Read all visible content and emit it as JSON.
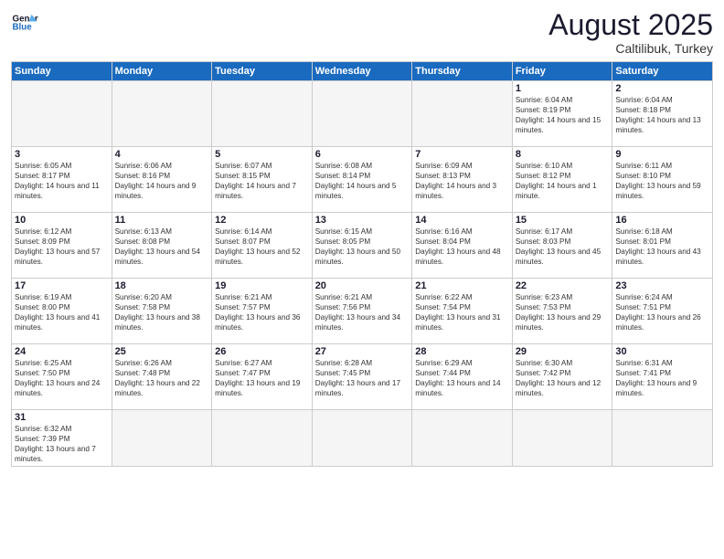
{
  "header": {
    "logo_line1": "General",
    "logo_line2": "Blue",
    "month_title": "August 2025",
    "subtitle": "Caltilibuk, Turkey"
  },
  "weekdays": [
    "Sunday",
    "Monday",
    "Tuesday",
    "Wednesday",
    "Thursday",
    "Friday",
    "Saturday"
  ],
  "weeks": [
    [
      {
        "day": "",
        "info": ""
      },
      {
        "day": "",
        "info": ""
      },
      {
        "day": "",
        "info": ""
      },
      {
        "day": "",
        "info": ""
      },
      {
        "day": "",
        "info": ""
      },
      {
        "day": "1",
        "info": "Sunrise: 6:04 AM\nSunset: 8:19 PM\nDaylight: 14 hours and 15 minutes."
      },
      {
        "day": "2",
        "info": "Sunrise: 6:04 AM\nSunset: 8:18 PM\nDaylight: 14 hours and 13 minutes."
      }
    ],
    [
      {
        "day": "3",
        "info": "Sunrise: 6:05 AM\nSunset: 8:17 PM\nDaylight: 14 hours and 11 minutes."
      },
      {
        "day": "4",
        "info": "Sunrise: 6:06 AM\nSunset: 8:16 PM\nDaylight: 14 hours and 9 minutes."
      },
      {
        "day": "5",
        "info": "Sunrise: 6:07 AM\nSunset: 8:15 PM\nDaylight: 14 hours and 7 minutes."
      },
      {
        "day": "6",
        "info": "Sunrise: 6:08 AM\nSunset: 8:14 PM\nDaylight: 14 hours and 5 minutes."
      },
      {
        "day": "7",
        "info": "Sunrise: 6:09 AM\nSunset: 8:13 PM\nDaylight: 14 hours and 3 minutes."
      },
      {
        "day": "8",
        "info": "Sunrise: 6:10 AM\nSunset: 8:12 PM\nDaylight: 14 hours and 1 minute."
      },
      {
        "day": "9",
        "info": "Sunrise: 6:11 AM\nSunset: 8:10 PM\nDaylight: 13 hours and 59 minutes."
      }
    ],
    [
      {
        "day": "10",
        "info": "Sunrise: 6:12 AM\nSunset: 8:09 PM\nDaylight: 13 hours and 57 minutes."
      },
      {
        "day": "11",
        "info": "Sunrise: 6:13 AM\nSunset: 8:08 PM\nDaylight: 13 hours and 54 minutes."
      },
      {
        "day": "12",
        "info": "Sunrise: 6:14 AM\nSunset: 8:07 PM\nDaylight: 13 hours and 52 minutes."
      },
      {
        "day": "13",
        "info": "Sunrise: 6:15 AM\nSunset: 8:05 PM\nDaylight: 13 hours and 50 minutes."
      },
      {
        "day": "14",
        "info": "Sunrise: 6:16 AM\nSunset: 8:04 PM\nDaylight: 13 hours and 48 minutes."
      },
      {
        "day": "15",
        "info": "Sunrise: 6:17 AM\nSunset: 8:03 PM\nDaylight: 13 hours and 45 minutes."
      },
      {
        "day": "16",
        "info": "Sunrise: 6:18 AM\nSunset: 8:01 PM\nDaylight: 13 hours and 43 minutes."
      }
    ],
    [
      {
        "day": "17",
        "info": "Sunrise: 6:19 AM\nSunset: 8:00 PM\nDaylight: 13 hours and 41 minutes."
      },
      {
        "day": "18",
        "info": "Sunrise: 6:20 AM\nSunset: 7:58 PM\nDaylight: 13 hours and 38 minutes."
      },
      {
        "day": "19",
        "info": "Sunrise: 6:21 AM\nSunset: 7:57 PM\nDaylight: 13 hours and 36 minutes."
      },
      {
        "day": "20",
        "info": "Sunrise: 6:21 AM\nSunset: 7:56 PM\nDaylight: 13 hours and 34 minutes."
      },
      {
        "day": "21",
        "info": "Sunrise: 6:22 AM\nSunset: 7:54 PM\nDaylight: 13 hours and 31 minutes."
      },
      {
        "day": "22",
        "info": "Sunrise: 6:23 AM\nSunset: 7:53 PM\nDaylight: 13 hours and 29 minutes."
      },
      {
        "day": "23",
        "info": "Sunrise: 6:24 AM\nSunset: 7:51 PM\nDaylight: 13 hours and 26 minutes."
      }
    ],
    [
      {
        "day": "24",
        "info": "Sunrise: 6:25 AM\nSunset: 7:50 PM\nDaylight: 13 hours and 24 minutes."
      },
      {
        "day": "25",
        "info": "Sunrise: 6:26 AM\nSunset: 7:48 PM\nDaylight: 13 hours and 22 minutes."
      },
      {
        "day": "26",
        "info": "Sunrise: 6:27 AM\nSunset: 7:47 PM\nDaylight: 13 hours and 19 minutes."
      },
      {
        "day": "27",
        "info": "Sunrise: 6:28 AM\nSunset: 7:45 PM\nDaylight: 13 hours and 17 minutes."
      },
      {
        "day": "28",
        "info": "Sunrise: 6:29 AM\nSunset: 7:44 PM\nDaylight: 13 hours and 14 minutes."
      },
      {
        "day": "29",
        "info": "Sunrise: 6:30 AM\nSunset: 7:42 PM\nDaylight: 13 hours and 12 minutes."
      },
      {
        "day": "30",
        "info": "Sunrise: 6:31 AM\nSunset: 7:41 PM\nDaylight: 13 hours and 9 minutes."
      }
    ],
    [
      {
        "day": "31",
        "info": "Sunrise: 6:32 AM\nSunset: 7:39 PM\nDaylight: 13 hours and 7 minutes."
      },
      {
        "day": "",
        "info": ""
      },
      {
        "day": "",
        "info": ""
      },
      {
        "day": "",
        "info": ""
      },
      {
        "day": "",
        "info": ""
      },
      {
        "day": "",
        "info": ""
      },
      {
        "day": "",
        "info": ""
      }
    ]
  ]
}
